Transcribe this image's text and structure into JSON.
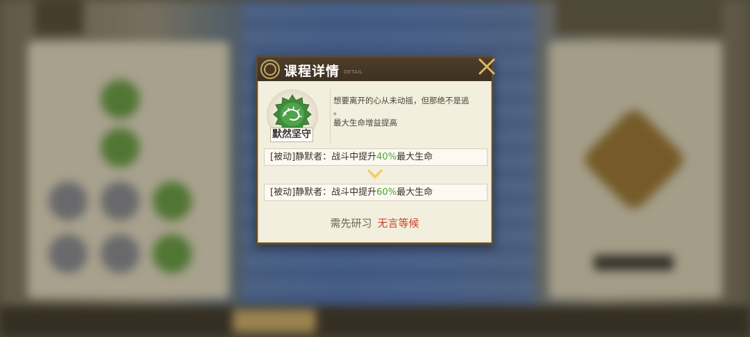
{
  "dialog": {
    "title": "课程详情",
    "subtitle": "DETAIL",
    "close_icon": "close-x-icon"
  },
  "skill": {
    "name": "默然坚守",
    "icon": "green-thorn-circle-icon",
    "description_line1": "想要离开的心从未动摇，但那绝不是逃",
    "description_line2": "。",
    "description_line3": "最大生命增益提高"
  },
  "effects": [
    {
      "prefix": "[被动]静默者：战斗中提升",
      "percent": "40%",
      "suffix": "最大生命"
    },
    {
      "prefix": "[被动]静默者：战斗中提升",
      "percent": "60%",
      "suffix": "最大生命"
    }
  ],
  "requirement": {
    "label": "需先研习",
    "value": "无言等候"
  },
  "colors": {
    "accent_green": "#4fa32c",
    "requirement_red": "#c9452b",
    "header_brown": "#4d3d2a",
    "gold": "#e0b95a"
  }
}
